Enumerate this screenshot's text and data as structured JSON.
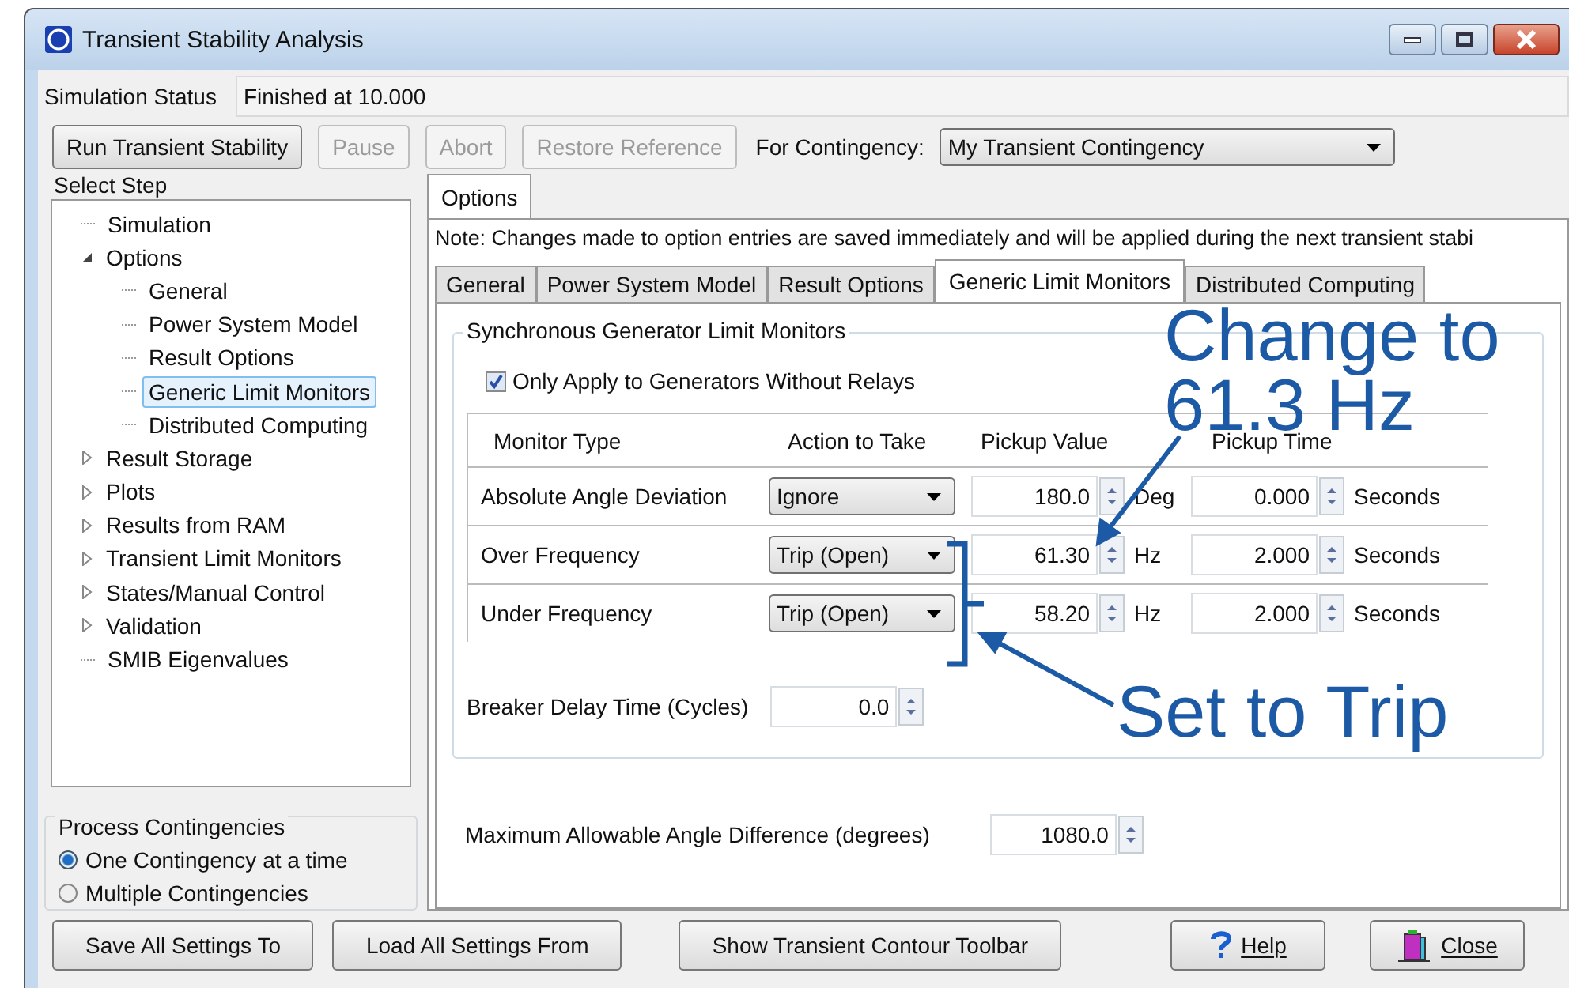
{
  "window": {
    "title": "Transient Stability Analysis"
  },
  "simulation_status": {
    "label": "Simulation Status",
    "value": "Finished at 10.000"
  },
  "toolbar": {
    "buttons": [
      {
        "label": "Run Transient Stability",
        "disabled": false
      },
      {
        "label": "Pause",
        "disabled": true
      },
      {
        "label": "Abort",
        "disabled": true
      },
      {
        "label": "Restore Reference",
        "disabled": true
      }
    ],
    "contingency_label": "For Contingency:",
    "contingency_value": "My Transient Contingency"
  },
  "select_step": {
    "title": "Select Step",
    "tree": [
      {
        "label": "Simulation",
        "selected": false
      },
      {
        "label": "Options",
        "selected": false,
        "expanded": true,
        "children": [
          {
            "label": "General",
            "selected": false
          },
          {
            "label": "Power System Model",
            "selected": false
          },
          {
            "label": "Result Options",
            "selected": false
          },
          {
            "label": "Generic Limit Monitors",
            "selected": true
          },
          {
            "label": "Distributed Computing",
            "selected": false
          }
        ]
      },
      {
        "label": "Result Storage",
        "selected": false,
        "expanded": false
      },
      {
        "label": "Plots",
        "selected": false,
        "expanded": false
      },
      {
        "label": "Results from RAM",
        "selected": false,
        "expanded": false
      },
      {
        "label": "Transient Limit Monitors",
        "selected": false,
        "expanded": false
      },
      {
        "label": "States/Manual Control",
        "selected": false,
        "expanded": false
      },
      {
        "label": "Validation",
        "selected": false,
        "expanded": false
      },
      {
        "label": "SMIB Eigenvalues",
        "selected": false
      }
    ]
  },
  "process_contingencies": {
    "title": "Process Contingencies",
    "options": [
      {
        "label": "One Contingency at a time",
        "selected": true
      },
      {
        "label": "Multiple Contingencies",
        "selected": false
      }
    ]
  },
  "main_tabs": [
    {
      "label": "Options",
      "selected": true
    }
  ],
  "note": "Note: Changes made to option entries are saved immediately and will be applied during the next transient stabi",
  "option_tabs": [
    {
      "label": "General",
      "selected": false
    },
    {
      "label": "Power System Model",
      "selected": false
    },
    {
      "label": "Result Options",
      "selected": false
    },
    {
      "label": "Generic Limit Monitors",
      "selected": true
    },
    {
      "label": "Distributed Computing",
      "selected": false
    }
  ],
  "generator_monitors": {
    "title": "Synchronous Generator Limit Monitors",
    "only_without_relays": {
      "label": "Only Apply to Generators Without Relays",
      "checked": true
    },
    "columns": [
      "Monitor Type",
      "Action to Take",
      "Pickup Value",
      "Pickup Time"
    ],
    "rows": [
      {
        "monitor_type": "Absolute Angle Deviation",
        "action": "Ignore",
        "pickup_value": "180.0",
        "value_unit": "Deg",
        "pickup_time": "0.000",
        "time_unit": "Seconds"
      },
      {
        "monitor_type": "Over Frequency",
        "action": "Trip (Open)",
        "pickup_value": "61.30",
        "value_unit": "Hz",
        "pickup_time": "2.000",
        "time_unit": "Seconds"
      },
      {
        "monitor_type": "Under Frequency",
        "action": "Trip (Open)",
        "pickup_value": "58.20",
        "value_unit": "Hz",
        "pickup_time": "2.000",
        "time_unit": "Seconds"
      }
    ],
    "breaker_delay": {
      "label": "Breaker Delay Time (Cycles)",
      "value": "0.0"
    }
  },
  "max_angle": {
    "label": "Maximum Allowable Angle Difference (degrees)",
    "value": "1080.0"
  },
  "footer_buttons": [
    {
      "label": "Save All Settings To",
      "kind": "plain"
    },
    {
      "label": "Load All Settings From",
      "kind": "plain"
    },
    {
      "label": "Show Transient Contour Toolbar",
      "kind": "plain"
    },
    {
      "label": "Help",
      "kind": "help"
    },
    {
      "label": "Close",
      "kind": "close"
    }
  ],
  "annotations": [
    {
      "text": "Change to 61.3 Hz",
      "kind": "value"
    },
    {
      "text": "Set to Trip",
      "kind": "action"
    }
  ]
}
